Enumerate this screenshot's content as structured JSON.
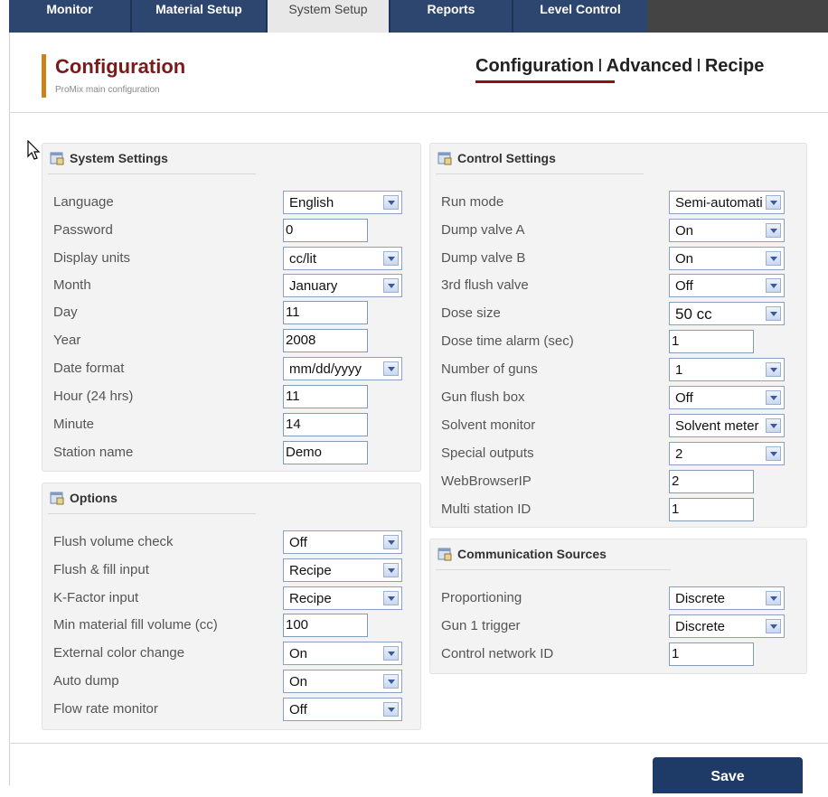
{
  "tabs": [
    {
      "label": "Monitor"
    },
    {
      "label": "Material Setup"
    },
    {
      "label": "System Setup",
      "active": true
    },
    {
      "label": "Reports"
    },
    {
      "label": "Level Control"
    }
  ],
  "header": {
    "title": "Configuration",
    "subtitle": "ProMix main configuration",
    "nav": [
      "Configuration",
      "Advanced",
      "Recipe"
    ],
    "nav_separator": "I",
    "active_nav": "Configuration"
  },
  "system_settings": {
    "title": "System Settings",
    "rows": [
      {
        "label": "Language",
        "kind": "select",
        "value": "English"
      },
      {
        "label": "Password",
        "kind": "input",
        "value": "0"
      },
      {
        "label": "Display units",
        "kind": "select",
        "value": "cc/lit"
      },
      {
        "label": "Month",
        "kind": "select",
        "value": "January"
      },
      {
        "label": "Day",
        "kind": "input",
        "value": "11"
      },
      {
        "label": "Year",
        "kind": "input",
        "value": "2008"
      },
      {
        "label": "Date format",
        "kind": "select",
        "value": "mm/dd/yyyy"
      },
      {
        "label": "Hour (24 hrs)",
        "kind": "input",
        "value": "11"
      },
      {
        "label": "Minute",
        "kind": "input",
        "value": "14"
      },
      {
        "label": "Station name",
        "kind": "input",
        "value": "Demo"
      }
    ]
  },
  "options": {
    "title": "Options",
    "rows": [
      {
        "label": "Flush volume check",
        "kind": "select",
        "value": "Off"
      },
      {
        "label": "Flush & fill input",
        "kind": "select",
        "value": "Recipe"
      },
      {
        "label": "K-Factor input",
        "kind": "select",
        "value": "Recipe"
      },
      {
        "label": "Min material fill volume (cc)",
        "kind": "input",
        "value": "100"
      },
      {
        "label": "External color change",
        "kind": "select",
        "value": "On"
      },
      {
        "label": "Auto dump",
        "kind": "select",
        "value": "On"
      },
      {
        "label": "Flow rate monitor",
        "kind": "select",
        "value": "Off"
      }
    ]
  },
  "control_settings": {
    "title": "Control Settings",
    "rows": [
      {
        "label": "Run mode",
        "kind": "select",
        "value": "Semi-automatic"
      },
      {
        "label": "Dump valve A",
        "kind": "select",
        "value": "On"
      },
      {
        "label": "Dump valve B",
        "kind": "select",
        "value": "On"
      },
      {
        "label": "3rd flush valve",
        "kind": "select",
        "value": "Off"
      },
      {
        "label": "Dose size",
        "kind": "select",
        "value": "50 cc"
      },
      {
        "label": "Dose time alarm (sec)",
        "kind": "input",
        "value": "1"
      },
      {
        "label": "Number of guns",
        "kind": "select",
        "value": "1"
      },
      {
        "label": "Gun flush box",
        "kind": "select",
        "value": "Off"
      },
      {
        "label": "Solvent monitor",
        "kind": "select",
        "value": "Solvent meter"
      },
      {
        "label": "Special outputs",
        "kind": "select",
        "value": "2"
      },
      {
        "label": "WebBrowserIP",
        "kind": "input",
        "value": "2"
      },
      {
        "label": "Multi station ID",
        "kind": "input",
        "value": "1"
      }
    ]
  },
  "communication_sources": {
    "title": "Communication Sources",
    "rows": [
      {
        "label": "Proportioning",
        "kind": "select",
        "value": "Discrete"
      },
      {
        "label": "Gun 1 trigger",
        "kind": "select",
        "value": "Discrete"
      },
      {
        "label": "Control network ID",
        "kind": "input",
        "value": "1"
      }
    ]
  },
  "footer": {
    "save_label": "Save"
  },
  "icons": {
    "panel": "settings-panel-icon",
    "cursor": "mouse-pointer-icon"
  },
  "colors": {
    "tab_bar": "#1e3355",
    "title": "#7a1a1a",
    "accent": "#c8841a",
    "save_button": "#1e3a66"
  }
}
